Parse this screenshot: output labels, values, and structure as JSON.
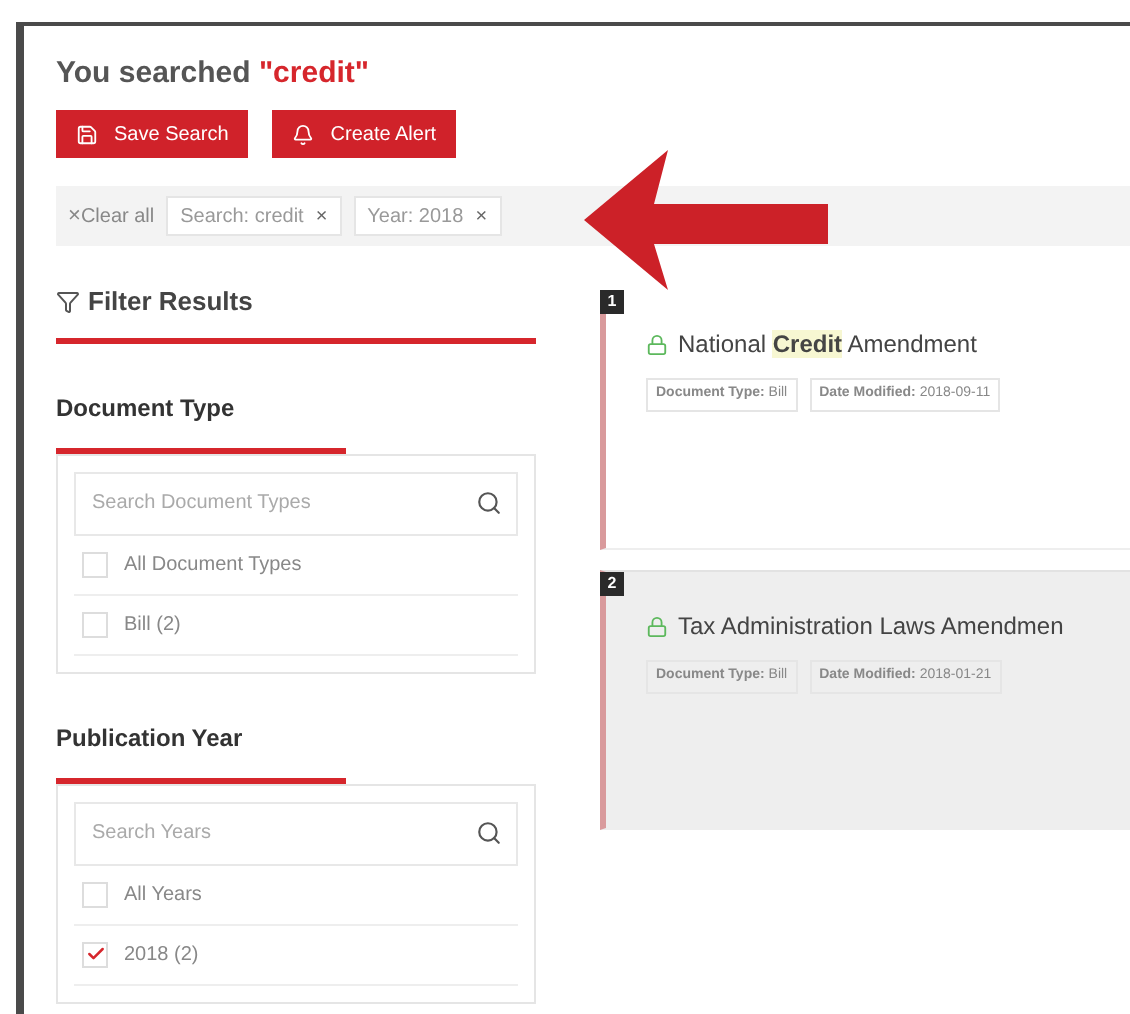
{
  "heading": {
    "prefix": "You searched ",
    "query": "\"credit\""
  },
  "actions": [
    {
      "kind": "save",
      "label": "Save Search"
    },
    {
      "kind": "alert",
      "label": "Create Alert"
    }
  ],
  "active_filters": {
    "clear_mark": "×",
    "clear": "Clear all",
    "chips": [
      {
        "label": "Search: credit",
        "remove": "×"
      },
      {
        "label": "Year: 2018",
        "remove": "×"
      }
    ]
  },
  "filter_panel": {
    "title": "Filter Results",
    "sections": [
      {
        "title": "Document Type",
        "placeholder": "Search Document Types",
        "options": [
          {
            "label": "All Document Types",
            "checked": false
          },
          {
            "label": "Bill (2)",
            "checked": false
          }
        ]
      },
      {
        "title": "Publication Year",
        "placeholder": "Search Years",
        "options": [
          {
            "label": "All Years",
            "checked": false
          },
          {
            "label": "2018 (2)",
            "checked": true
          }
        ]
      }
    ]
  },
  "results": [
    {
      "number": "1",
      "shaded": false,
      "title": [
        {
          "text": "National ",
          "highlight": false
        },
        {
          "text": "Credit",
          "highlight": true
        },
        {
          "text": " Amendment",
          "highlight": false
        }
      ],
      "meta": [
        {
          "label": "Document Type:",
          "value": "Bill"
        },
        {
          "label": "Date Modified:",
          "value": "2018-09-11"
        }
      ]
    },
    {
      "number": "2",
      "shaded": true,
      "title": [
        {
          "text": "Tax Administration Laws Amendmen",
          "highlight": false
        }
      ],
      "meta": [
        {
          "label": "Document Type:",
          "value": "Bill"
        },
        {
          "label": "Date Modified:",
          "value": "2018-01-21"
        }
      ]
    }
  ]
}
